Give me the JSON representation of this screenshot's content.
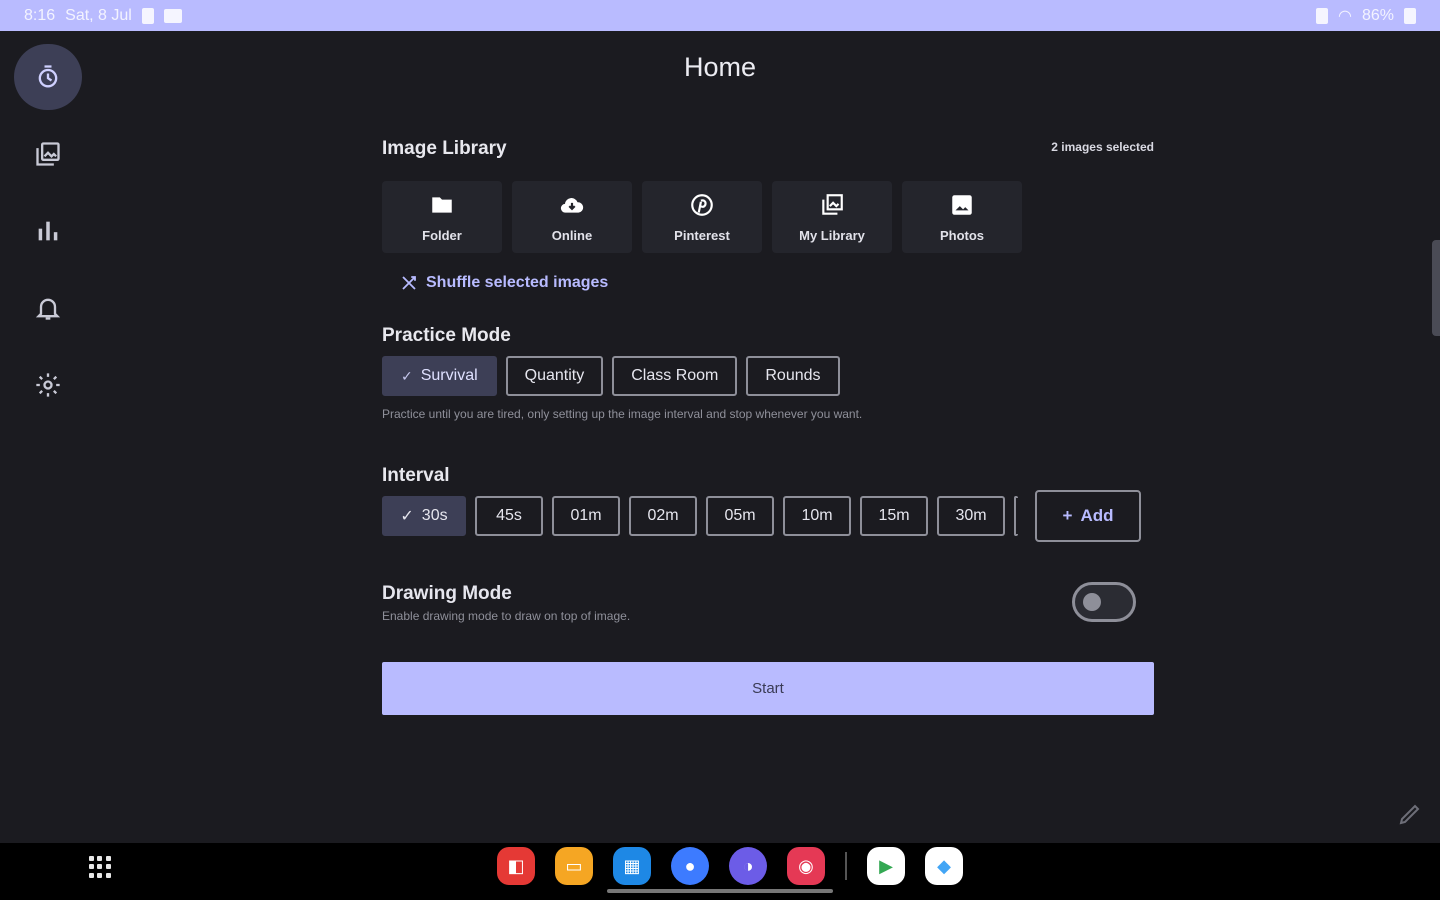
{
  "status_bar": {
    "time": "8:16",
    "date": "Sat, 8 Jul",
    "battery": "86%"
  },
  "nav_rail": {
    "items": [
      {
        "name": "timer-icon",
        "active": true
      },
      {
        "name": "gallery-icon",
        "active": false
      },
      {
        "name": "stats-icon",
        "active": false
      },
      {
        "name": "bell-icon",
        "active": false
      },
      {
        "name": "settings-icon",
        "active": false
      }
    ]
  },
  "page": {
    "title": "Home"
  },
  "image_library": {
    "title": "Image Library",
    "selected_count": "2 images selected",
    "sources": [
      {
        "label": "Folder",
        "icon": "folder-icon"
      },
      {
        "label": "Online",
        "icon": "cloud-download-icon"
      },
      {
        "label": "Pinterest",
        "icon": "pinterest-icon"
      },
      {
        "label": "My Library",
        "icon": "library-icon"
      },
      {
        "label": "Photos",
        "icon": "photo-icon"
      }
    ],
    "shuffle_label": "Shuffle selected images"
  },
  "practice_mode": {
    "title": "Practice Mode",
    "options": [
      "Survival",
      "Quantity",
      "Class Room",
      "Rounds"
    ],
    "selected": "Survival",
    "description": "Practice until you are tired, only setting up the image interval and stop whenever you want."
  },
  "interval": {
    "title": "Interval",
    "options": [
      "30s",
      "45s",
      "01m",
      "02m",
      "05m",
      "10m",
      "15m",
      "30m"
    ],
    "selected": "30s",
    "add_label": "Add"
  },
  "drawing_mode": {
    "title": "Drawing Mode",
    "description": "Enable drawing mode to draw on top of image.",
    "enabled": false
  },
  "start_label": "Start",
  "taskbar": {
    "apps": [
      {
        "name": "app-red",
        "color": "#e53935"
      },
      {
        "name": "app-files",
        "color": "#f5a623"
      },
      {
        "name": "app-calendar",
        "color": "#1e88e5"
      },
      {
        "name": "app-messages",
        "color": "#3d7bff"
      },
      {
        "name": "app-browser",
        "color": "#6c5ce7"
      },
      {
        "name": "app-screen-recorder",
        "color": "#e53955"
      },
      {
        "name": "app-play-store",
        "color": "#ffffff"
      },
      {
        "name": "app-flutter",
        "color": "#ffffff"
      }
    ]
  }
}
